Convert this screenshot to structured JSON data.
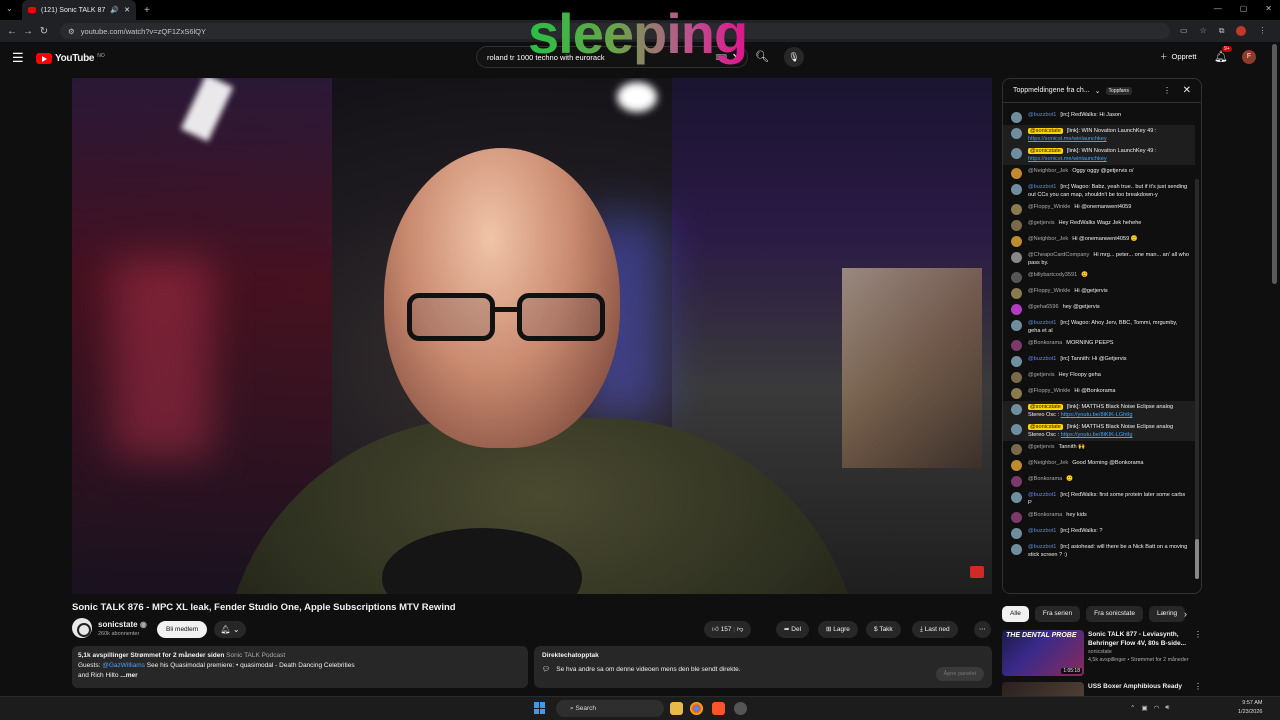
{
  "browser": {
    "tab_title": "(121) Sonic TALK 876 - MPC",
    "url": "youtube.com/watch?v=zQF1ZxS6lQY",
    "profile_initial": "F"
  },
  "yt": {
    "logo": "YouTube",
    "logo_region": "NO",
    "search_value": "roland tr 1000 techno with eurorack",
    "create_label": "Opprett",
    "notif_count": "9+",
    "avatar_initial": "F"
  },
  "overlay": {
    "word": "sleeping"
  },
  "video": {
    "title": "Sonic TALK 876 - MPC XL leak, Fender Studio One, Apple Subscriptions MTV Rewind",
    "channel": "sonicstate",
    "subscribers": "260k abonnenter",
    "join_label": "Bli medlem",
    "likes": "157",
    "share_label": "Del",
    "save_label": "Lagre",
    "thanks_label": "Takk",
    "download_label": "Last ned"
  },
  "description": {
    "stats": "5,1k avspillinger  Strømmet for 2 måneder siden",
    "podcast": "Sonic TALK Podcast",
    "guests_prefix": "Guests:",
    "guest_link": "@GazWilliams",
    "premiere": "See his Quasimodal premiere:",
    "premiere_title": "• quasimodal - Death Dancing Celebrities",
    "and_rich": "and Rich Hilto",
    "more": "...mer"
  },
  "livechat_replay": {
    "heading": "Direktechatopptak",
    "text": "Se hva andre sa om denne videoen mens den ble sendt direkte.",
    "button": "Åpne panelet"
  },
  "chat": {
    "header": "Toppmeldingene fra ch...",
    "topfans": "Toppfans",
    "messages": [
      {
        "author": "@buzzbot1",
        "text": "[irc] RedWalks: Hi Jason",
        "type": "mod",
        "color": "#6f8fa0"
      },
      {
        "author": "@sonicstate",
        "text": "[link]: WIN Novation LaunchKey 49 :",
        "link": "https://sonicst.me/winlaunchkey",
        "type": "own",
        "color": "#6f8fa0"
      },
      {
        "author": "@sonicstate",
        "text": "[link]: WIN Novation LaunchKey 49 :",
        "link": "https://sonicst.me/winlaunchkey",
        "type": "own",
        "color": "#6f8fa0"
      },
      {
        "author": "@Neighbor_Jek",
        "text": "Oggy oggy @getjervis o/",
        "type": "",
        "color": "#c08a30"
      },
      {
        "author": "@buzzbot1",
        "text": "[irc] Wagoo: Babz, yeah true.. but if it's just sending out CCs you can map, shouldn't be too breakdown-y",
        "type": "mod",
        "color": "#6f8fa0"
      },
      {
        "author": "@Floppy_Winkle",
        "text": "Hi @onemanwent4059",
        "type": "",
        "color": "#8a7a50"
      },
      {
        "author": "@getjervis",
        "text": "Hey RedWalks Wagz Jek hehehe",
        "type": "",
        "color": "#7a6a4a"
      },
      {
        "author": "@Neighbor_Jek",
        "text": "Hi @onemanwent4059 🙂",
        "type": "",
        "color": "#c08a30"
      },
      {
        "author": "@CheapoCardCompany",
        "text": "Hi mrg... peter... one man... an' all who pass by.",
        "type": "",
        "color": "#888"
      },
      {
        "author": "@billybartcody3591",
        "text": "😢",
        "type": "",
        "color": "#555"
      },
      {
        "author": "@Floppy_Winkle",
        "text": "Hi @getjervis",
        "type": "",
        "color": "#8a7a50"
      },
      {
        "author": "@geha6596",
        "text": "hey @getjervis",
        "type": "",
        "color": "#b03cc0"
      },
      {
        "author": "@buzzbot1",
        "text": "[irc] Wagoo: Ahoy Jerv, BBC, Tommi, mrgumby, geha et al",
        "type": "mod",
        "color": "#6f8fa0"
      },
      {
        "author": "@Bonkorama",
        "text": "MORNING PEEPS",
        "type": "",
        "color": "#7a3a6a"
      },
      {
        "author": "@buzzbot1",
        "text": "[irc] Tannith: Hi @Getjervis",
        "type": "mod",
        "color": "#6f8fa0"
      },
      {
        "author": "@getjervis",
        "text": "Hey Floopy geha",
        "type": "",
        "color": "#7a6a4a"
      },
      {
        "author": "@Floppy_Winkle",
        "text": "Hi @Bonkorama",
        "type": "",
        "color": "#8a7a50"
      },
      {
        "author": "@sonicstate",
        "text": "[link]: MATTHS Black Noise Eclipse analog Stereo Osc :",
        "link": "https://youtu.be/8iKIK-LGhtIg",
        "type": "own",
        "color": "#6f8fa0"
      },
      {
        "author": "@sonicstate",
        "text": "[link]: MATTHS Black Noise Eclipse analog Stereo Osc :",
        "link": "https://youtu.be/8iKIK-LGhtIg",
        "type": "own",
        "color": "#6f8fa0"
      },
      {
        "author": "@getjervis",
        "text": "Tannith 🙌",
        "type": "",
        "color": "#7a6a4a"
      },
      {
        "author": "@Neighbor_Jek",
        "text": "Good Morning @Bonkorama",
        "type": "",
        "color": "#c08a30"
      },
      {
        "author": "@Bonkorama",
        "text": "🙂",
        "type": "",
        "color": "#7a3a6a"
      },
      {
        "author": "@buzzbot1",
        "text": "[irc] RedWalks: first some protein later some carbs P",
        "type": "mod",
        "color": "#6f8fa0"
      },
      {
        "author": "@Bonkorama",
        "text": "hey kids",
        "type": "",
        "color": "#7a3a6a"
      },
      {
        "author": "@buzzbot1",
        "text": "[irc] RedWalks: ?",
        "type": "mod",
        "color": "#6f8fa0"
      },
      {
        "author": "@buzzbot1",
        "text": "[irc] asiohead: will there be a Nick Batt on a moving stick screen ? :)",
        "type": "mod",
        "color": "#6f8fa0"
      }
    ]
  },
  "chips": [
    "Alle",
    "Fra serien",
    "Fra sonicstate",
    "Læring"
  ],
  "recommendations": [
    {
      "thumb_text": "THE DENTAL PROBE",
      "duration": "1:05:18",
      "title": "Sonic TALK 877 - Leviasynth, Behringer Flow 4V, 80s B-side...",
      "channel": "sonicstate",
      "meta": "4,5k avspillinger • Strømmet for 2 måneder"
    },
    {
      "thumb_text": "",
      "duration": "",
      "title": "USS Boxer Amphibious Ready",
      "channel": "",
      "meta": ""
    }
  ],
  "taskbar": {
    "search": "Search",
    "time": "9:57 AM",
    "date": "1/23/2026"
  }
}
